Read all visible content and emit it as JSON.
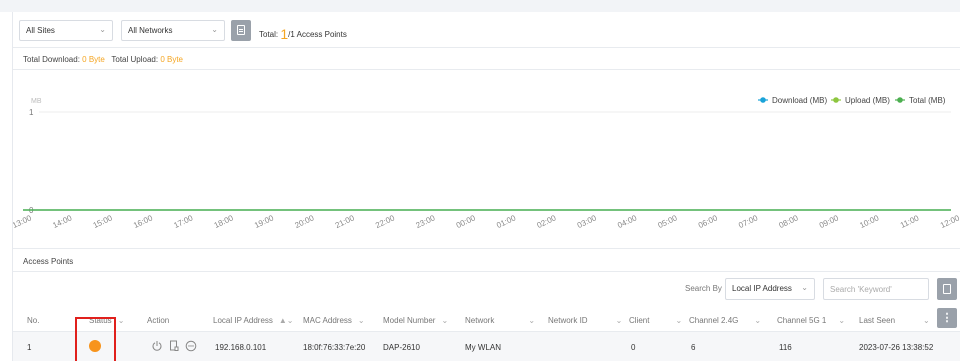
{
  "filters": {
    "sites": {
      "selected": "All Sites"
    },
    "networks": {
      "selected": "All Networks"
    },
    "total": {
      "prefix": "Total:",
      "count": "1",
      "suffix": "/1 Access Points"
    }
  },
  "totals": {
    "download_label": "Total Download:",
    "download_value": "0 Byte",
    "upload_label": "Total Upload:",
    "upload_value": "0 Byte"
  },
  "chart_data": {
    "type": "line",
    "ylabel": "MB",
    "ylim": [
      0,
      1
    ],
    "yticks": [
      "0",
      "1"
    ],
    "x": [
      "13:00",
      "14:00",
      "15:00",
      "16:00",
      "17:00",
      "18:00",
      "19:00",
      "20:00",
      "21:00",
      "22:00",
      "23:00",
      "00:00",
      "01:00",
      "02:00",
      "03:00",
      "04:00",
      "05:00",
      "06:00",
      "07:00",
      "08:00",
      "09:00",
      "10:00",
      "11:00",
      "12:00"
    ],
    "series": [
      {
        "name": "Download (MB)",
        "color": "#1aa3d9",
        "values": [
          0,
          0,
          0,
          0,
          0,
          0,
          0,
          0,
          0,
          0,
          0,
          0,
          0,
          0,
          0,
          0,
          0,
          0,
          0,
          0,
          0,
          0,
          0,
          0
        ]
      },
      {
        "name": "Upload (MB)",
        "color": "#8dc63f",
        "values": [
          0,
          0,
          0,
          0,
          0,
          0,
          0,
          0,
          0,
          0,
          0,
          0,
          0,
          0,
          0,
          0,
          0,
          0,
          0,
          0,
          0,
          0,
          0,
          0
        ]
      },
      {
        "name": "Total (MB)",
        "color": "#4caf50",
        "values": [
          0,
          0,
          0,
          0,
          0,
          0,
          0,
          0,
          0,
          0,
          0,
          0,
          0,
          0,
          0,
          0,
          0,
          0,
          0,
          0,
          0,
          0,
          0,
          0
        ]
      }
    ],
    "legend_position": "top-right"
  },
  "access_points": {
    "title": "Access Points",
    "search_by_label": "Search By",
    "search_by_selected": "Local IP Address",
    "search_placeholder": "Search 'Keyword'",
    "columns": {
      "no": "No.",
      "status": "Status",
      "action": "Action",
      "local_ip": "Local IP Address",
      "mac": "MAC Address",
      "model": "Model Number",
      "network": "Network",
      "network_id": "Network ID",
      "client": "Client",
      "ch24": "Channel 2.4G",
      "ch5": "Channel 5G 1",
      "last_seen": "Last Seen"
    },
    "rows": [
      {
        "no": "1",
        "status_color": "#f7941d",
        "local_ip": "192.168.0.101",
        "mac": "18:0f:76:33:7e:20",
        "model": "DAP-2610",
        "network": "My WLAN",
        "network_id": "",
        "client": "0",
        "ch24": "6",
        "ch5": "116",
        "last_seen": "2023-07-26 13:38:52"
      }
    ]
  }
}
